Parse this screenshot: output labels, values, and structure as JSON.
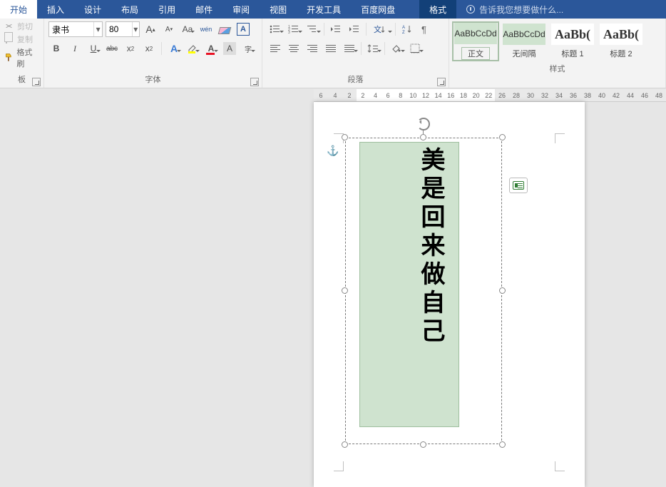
{
  "tabs": {
    "items": [
      "开始",
      "插入",
      "设计",
      "布局",
      "引用",
      "邮件",
      "审阅",
      "视图",
      "开发工具",
      "百度网盘"
    ],
    "context": "格式",
    "tell_me": "告诉我您想要做什么..."
  },
  "clipboard": {
    "cut": "剪切",
    "copy": "复制",
    "painter": "格式刷",
    "label": "板"
  },
  "font": {
    "name": "隶书",
    "size": "80",
    "grow": "A",
    "shrink": "A",
    "caps": "Aa",
    "phonetic": "wén",
    "clear": "",
    "boxed": "A",
    "bold": "B",
    "italic": "I",
    "underline": "U",
    "strike": "abc",
    "sub": "x₂",
    "sup": "x²",
    "effects": "A",
    "highlight": "",
    "color": "A",
    "charshade": "A",
    "circled": "字",
    "label": "字体"
  },
  "paragraph": {
    "label": "段落"
  },
  "styles": {
    "label": "样式",
    "items": [
      {
        "preview": "AaBbCcDd",
        "name": "正文",
        "big": false
      },
      {
        "preview": "AaBbCcDd",
        "name": "无间隔",
        "big": false
      },
      {
        "preview": "AaBb(",
        "name": "标题 1",
        "big": true
      },
      {
        "preview": "AaBb(",
        "name": "标题 2",
        "big": true
      }
    ]
  },
  "ruler": {
    "left": [
      "6",
      "4",
      "2"
    ],
    "right": [
      "2",
      "4",
      "6",
      "8",
      "10",
      "12",
      "14",
      "16",
      "18",
      "20",
      "22"
    ],
    "far": [
      "26",
      "28",
      "30",
      "32",
      "34",
      "36",
      "38",
      "40",
      "42",
      "44",
      "46",
      "48"
    ]
  },
  "document": {
    "textbox_text": "美是回来做自己"
  }
}
